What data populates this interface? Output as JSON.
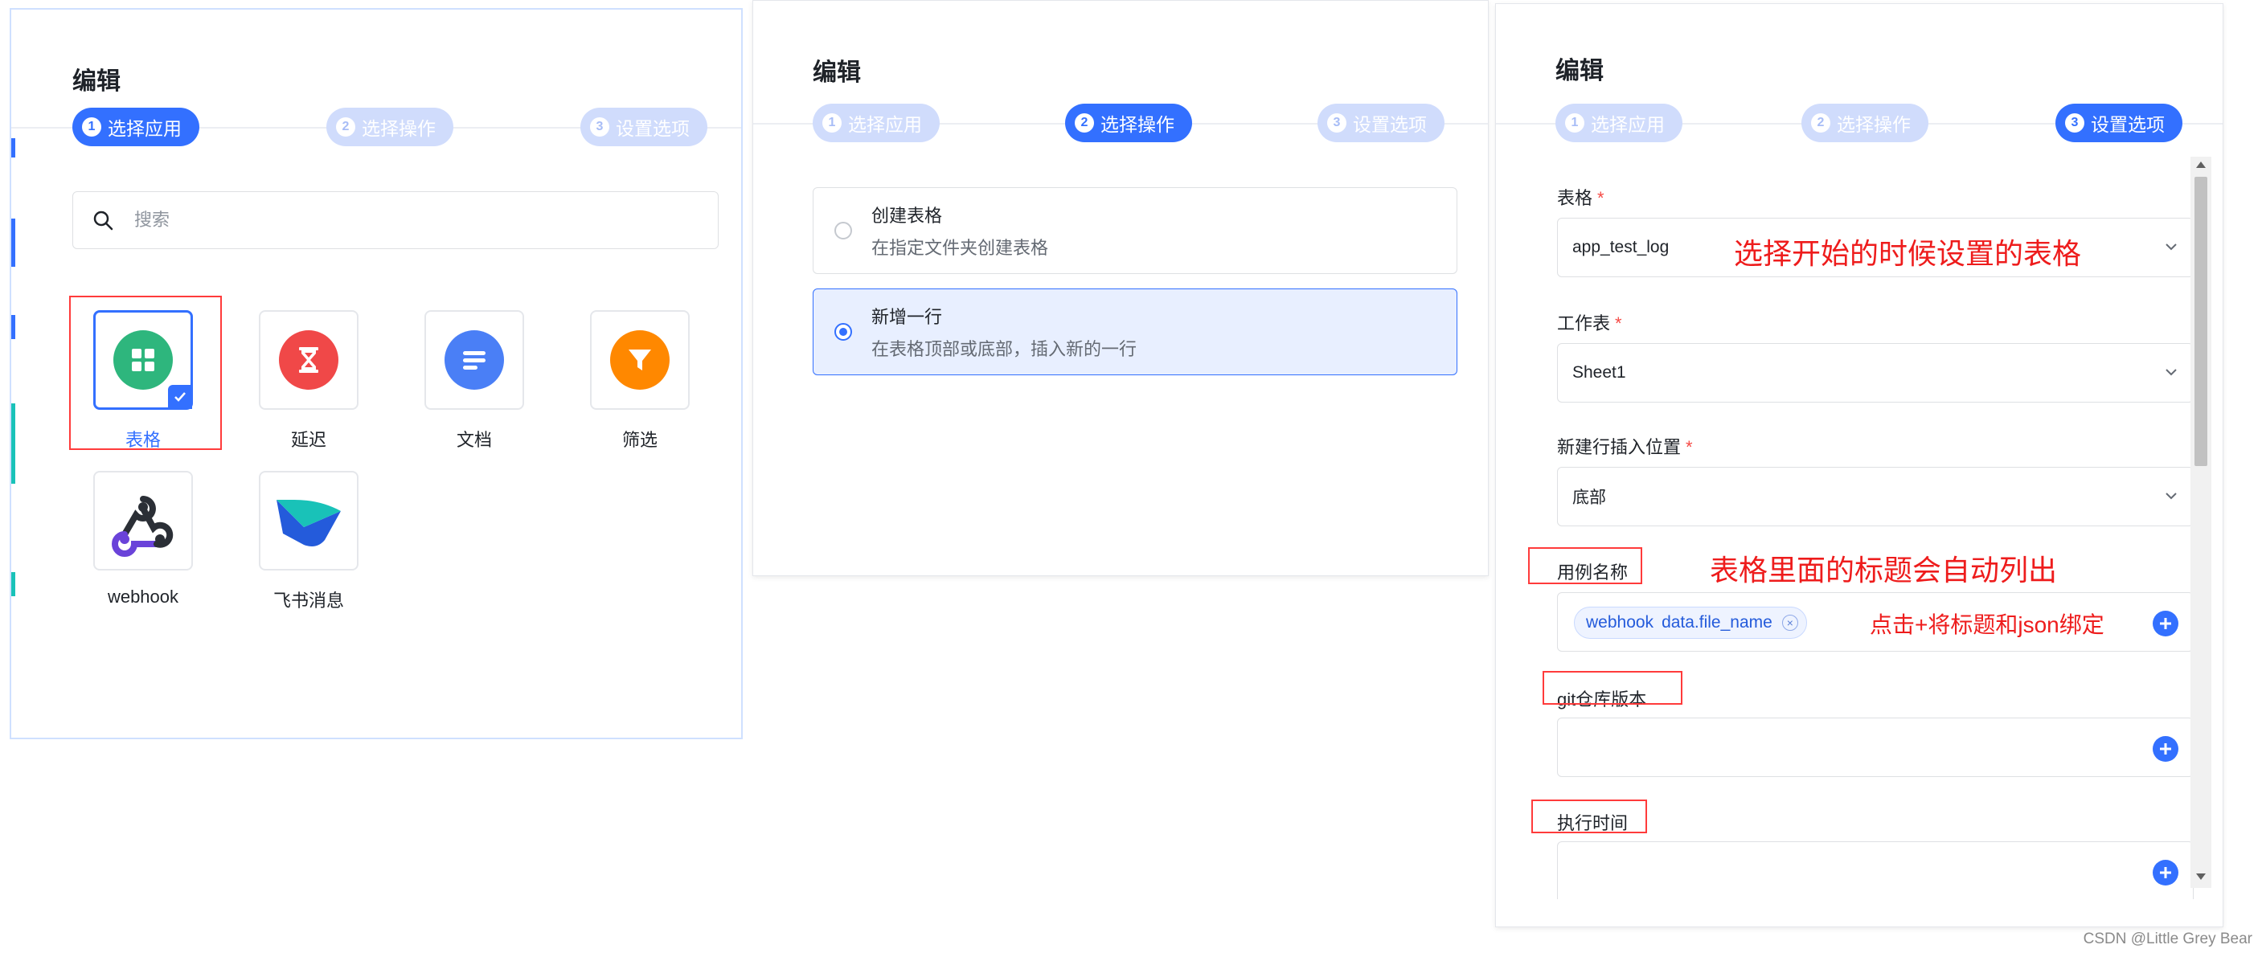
{
  "panel_left": {
    "title": "编辑",
    "steps": [
      {
        "num": "1",
        "label": "选择应用",
        "active": true
      },
      {
        "num": "2",
        "label": "选择操作",
        "active": false
      },
      {
        "num": "3",
        "label": "设置选项",
        "active": false
      }
    ],
    "search": {
      "placeholder": "搜索"
    },
    "apps": [
      {
        "label": "表格",
        "icon": "table-grid-icon",
        "color": "#2eb67d",
        "selected": true
      },
      {
        "label": "延迟",
        "icon": "hourglass-icon",
        "color": "#f04848",
        "selected": false
      },
      {
        "label": "文档",
        "icon": "document-lines-icon",
        "color": "#4a7ff6",
        "selected": false
      },
      {
        "label": "筛选",
        "icon": "filter-funnel-icon",
        "color": "#ff8800",
        "selected": false
      },
      {
        "label": "webhook",
        "icon": "webhook-icon",
        "color": "#2b2f36",
        "selected": false
      },
      {
        "label": "飞书消息",
        "icon": "feishu-message-icon",
        "color": "#3370ff",
        "selected": false
      }
    ]
  },
  "panel_middle": {
    "title": "编辑",
    "steps": [
      {
        "num": "1",
        "label": "选择应用",
        "active": false
      },
      {
        "num": "2",
        "label": "选择操作",
        "active": true
      },
      {
        "num": "3",
        "label": "设置选项",
        "active": false
      }
    ],
    "options": [
      {
        "title": "创建表格",
        "desc": "在指定文件夹创建表格",
        "selected": false
      },
      {
        "title": "新增一行",
        "desc": "在表格顶部或底部，插入新的一行",
        "selected": true
      }
    ]
  },
  "panel_right": {
    "title": "编辑",
    "steps": [
      {
        "num": "1",
        "label": "选择应用",
        "active": false
      },
      {
        "num": "2",
        "label": "选择操作",
        "active": false
      },
      {
        "num": "3",
        "label": "设置选项",
        "active": true
      }
    ],
    "fields": {
      "sheet_label": "表格",
      "sheet_value": "app_test_log",
      "worksheet_label": "工作表",
      "worksheet_value": "Sheet1",
      "insert_pos_label": "新建行插入位置",
      "insert_pos_value": "底部",
      "case_name_label": "用例名称",
      "case_name_chip_tag": "webhook",
      "case_name_chip_value": "data.file_name",
      "git_label": "git仓库版本",
      "exec_time_label": "执行时间"
    },
    "required_mark": "*"
  },
  "annotations": {
    "choose_table": "选择开始的时候设置的表格",
    "titles_listed": "表格里面的标题会自动列出",
    "click_plus": "点击+将标题和json绑定"
  },
  "credit": "CSDN @Little Grey Bear",
  "colors": {
    "primary": "#3370ff",
    "step_inactive": "#d0dcfc",
    "annotation_red": "#ee1c1c"
  }
}
